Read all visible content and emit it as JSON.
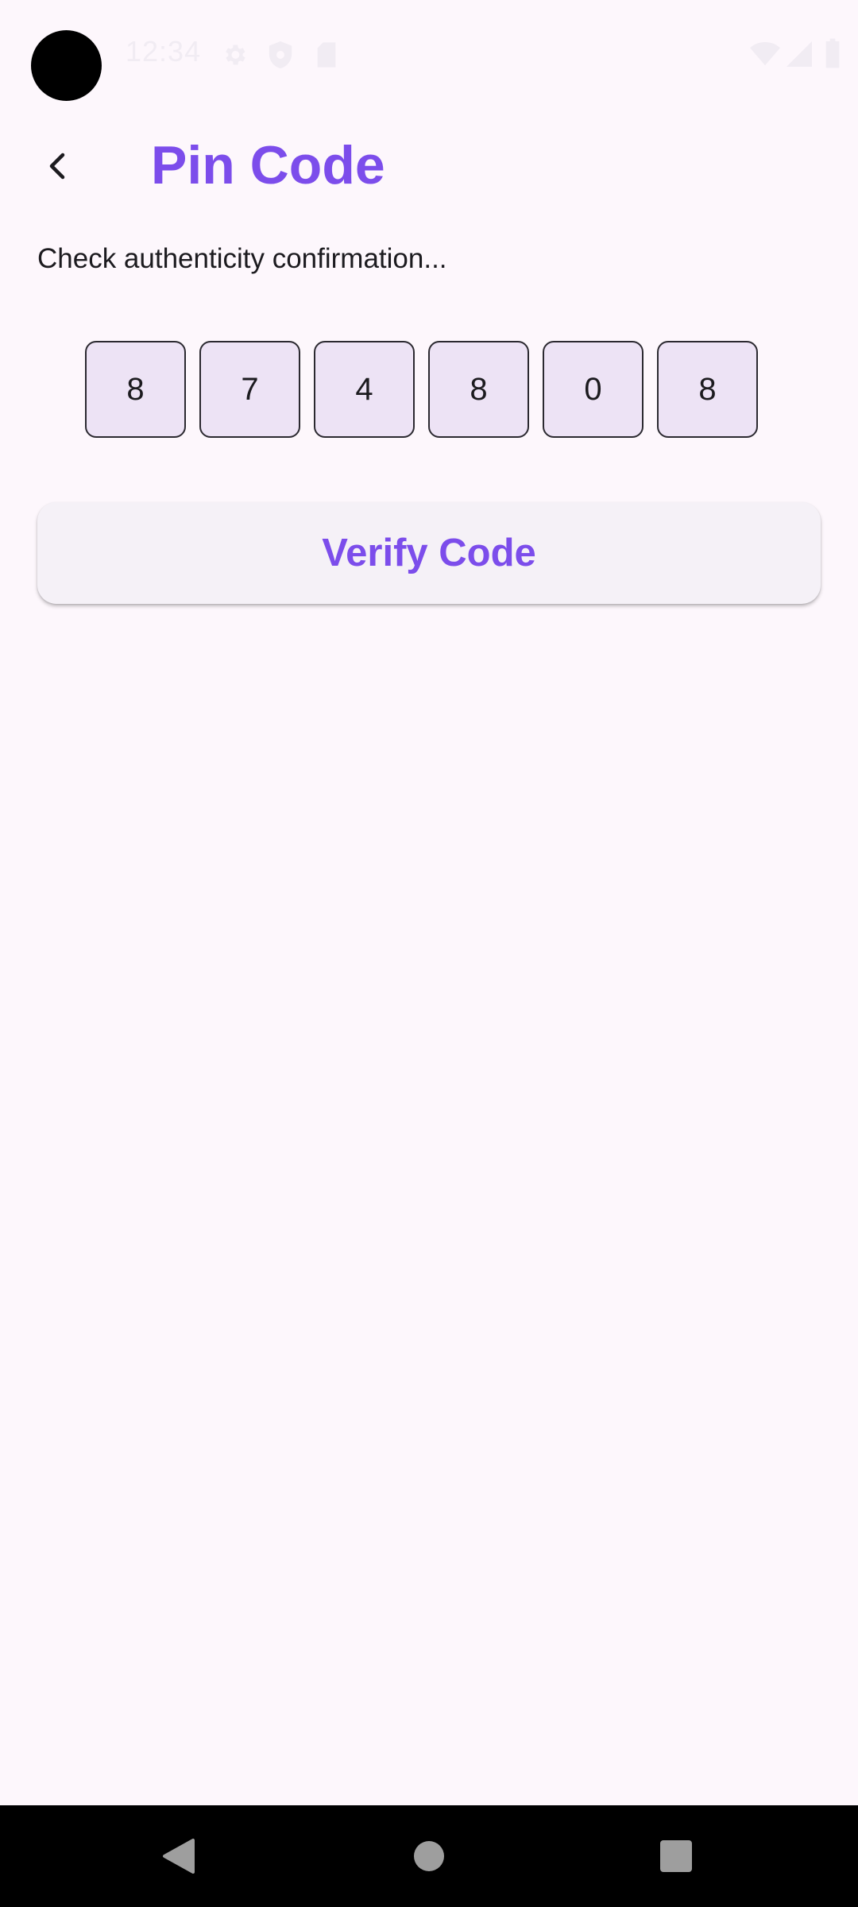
{
  "status_bar": {
    "time": "12:34",
    "icons": [
      "gear-icon",
      "shield-icon",
      "sim-card-icon",
      "wifi-icon",
      "signal-icon",
      "battery-icon"
    ]
  },
  "app_bar": {
    "title": "Pin Code",
    "back_icon": "chevron-left-icon"
  },
  "main": {
    "subtitle": "Check authenticity confirmation...",
    "pin_digits": [
      "8",
      "7",
      "4",
      "8",
      "0",
      "8"
    ],
    "verify_label": "Verify Code"
  },
  "nav_bar": {
    "icons": [
      "back-triangle-icon",
      "home-circle-icon",
      "recents-square-icon"
    ]
  },
  "colors": {
    "accent": "#7c4deb",
    "background": "#fdf7fc",
    "pin_fill": "#ede3f5",
    "button_fill": "#f5f1f7"
  }
}
